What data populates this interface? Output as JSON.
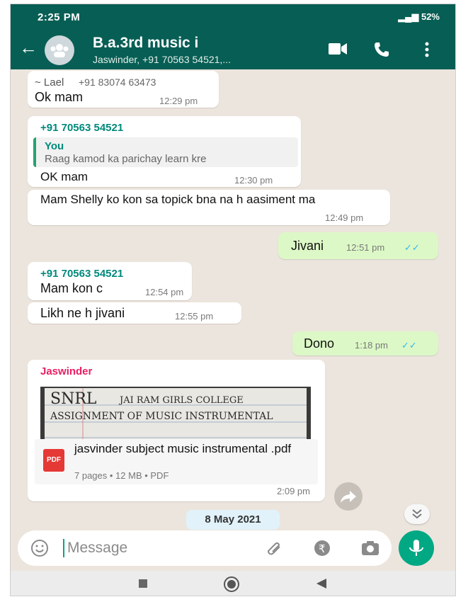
{
  "status_bar": {
    "time": "2:25 PM",
    "battery": "52%"
  },
  "header": {
    "title": "B.a.3rd music i",
    "subtitle": "Jaswinder, +91 70563 54521,..."
  },
  "messages": [
    {
      "sender": "~ Lael",
      "phone": "+91 83074 63473",
      "text": "Ok mam",
      "time": "12:29 pm"
    },
    {
      "sender": "+91 70563 54521",
      "quote_author": "You",
      "quote_text": "Raag kamod ka parichay learn kre",
      "text": "OK mam",
      "time": "12:30 pm"
    },
    {
      "text": "Mam Shelly ko kon sa topick bna na h aasiment  ma",
      "time": "12:49 pm"
    },
    {
      "text": "Jivani",
      "time": "12:51 pm"
    },
    {
      "sender": "+91 70563 54521",
      "text": "Mam kon c",
      "time": "12:54 pm"
    },
    {
      "text": "Likh ne h jivani",
      "time": "12:55 pm"
    },
    {
      "text": "Dono",
      "time": "1:18 pm"
    },
    {
      "sender": "Jaswinder",
      "doc_name": "jasvinder  subject music instrumental .pdf",
      "doc_meta": "7 pages • 12 MB • PDF",
      "doc_badge": "PDF",
      "preview_text": "JAI RAM GIRLS COLLEGE ASSIGNMENT OF MUSIC INSTRUMENTAL",
      "time": "2:09 pm"
    }
  ],
  "date_chip": "8 May 2021",
  "composer": {
    "placeholder": "Message"
  },
  "colors": {
    "header": "#075e54",
    "outgoing": "#dcf8c6",
    "accent": "#00a884"
  }
}
